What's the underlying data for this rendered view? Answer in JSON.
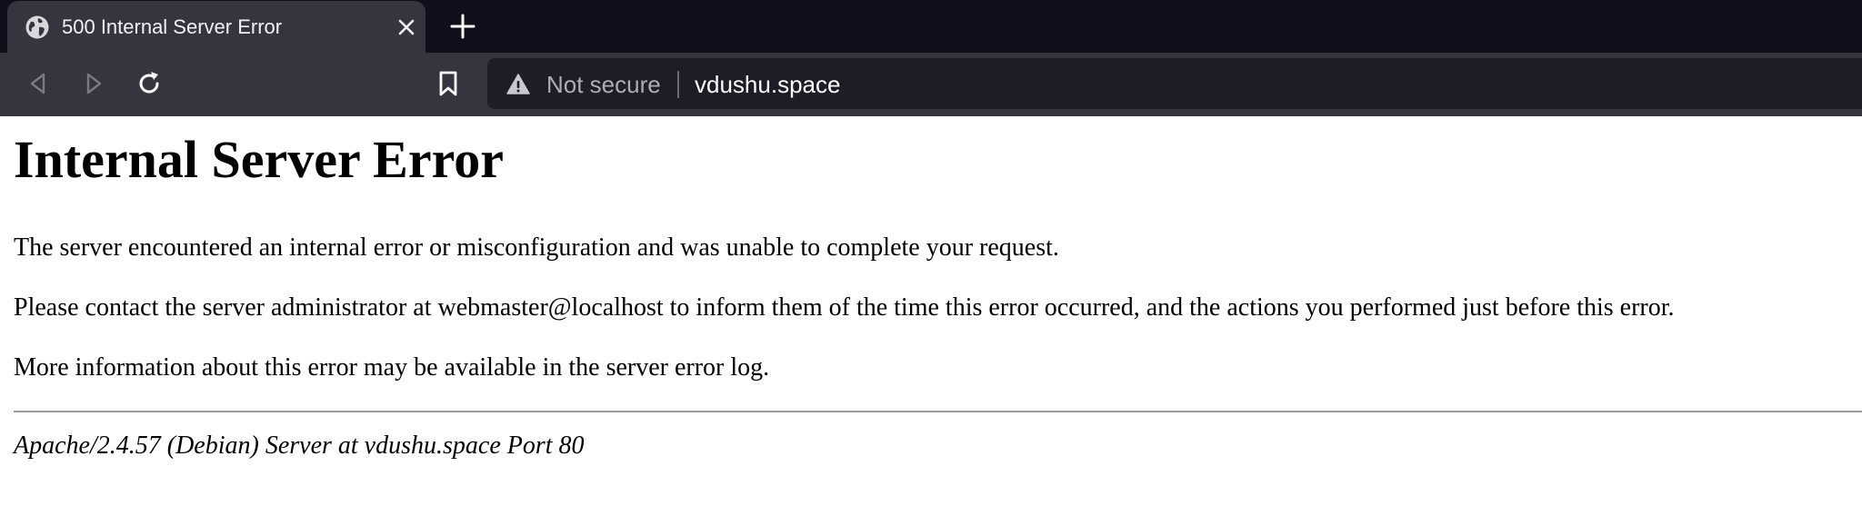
{
  "browser": {
    "tab": {
      "title": "500 Internal Server Error",
      "favicon": "globe-icon"
    },
    "toolbar": {
      "back": "back-arrow-icon",
      "forward": "forward-arrow-icon",
      "reload": "reload-icon",
      "bookmark": "bookmark-icon"
    },
    "urlbar": {
      "security_label": "Not secure",
      "url": "vdushu.space"
    },
    "colors": {
      "tabstrip_bg": "#0f0e1a",
      "toolbar_bg": "#35343f",
      "urlbar_bg": "#1d1c27"
    }
  },
  "page": {
    "heading": "Internal Server Error",
    "paragraphs": [
      "The server encountered an internal error or misconfiguration and was unable to complete your request.",
      "Please contact the server administrator at webmaster@localhost to inform them of the time this error occurred, and the actions you performed just before this error.",
      "More information about this error may be available in the server error log."
    ],
    "footer": "Apache/2.4.57 (Debian) Server at vdushu.space Port 80"
  }
}
